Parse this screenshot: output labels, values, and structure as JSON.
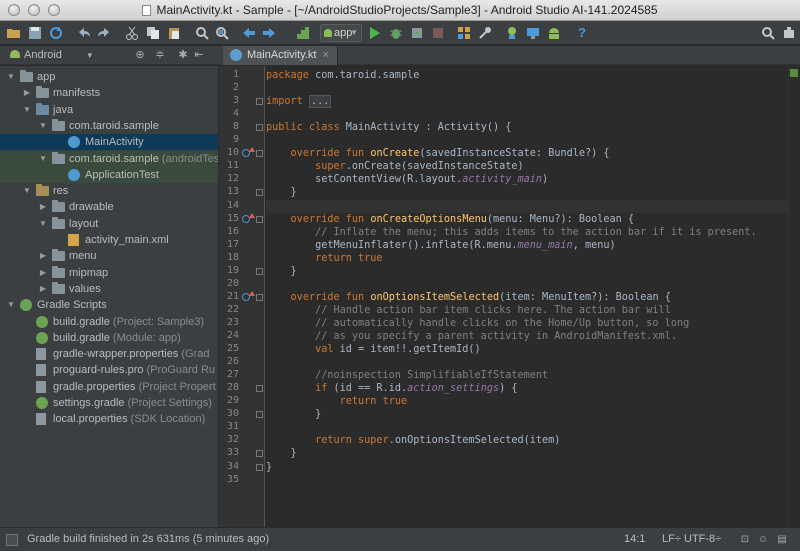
{
  "window": {
    "title": "MainActivity.kt - Sample - [~/AndroidStudioProjects/Sample3] - Android Studio AI-141.2024585"
  },
  "toolbar": {
    "run_config": "app",
    "icons": [
      "open-folder-icon",
      "save-icon",
      "sync-icon",
      "undo-icon",
      "redo-icon",
      "cut-icon",
      "copy-icon",
      "paste-icon",
      "find-icon",
      "replace-icon",
      "back-icon",
      "forward-icon",
      "build-icon",
      "run-icon",
      "debug-icon",
      "attach-icon",
      "stop-icon",
      "avd-manager-icon",
      "sdk-manager-icon",
      "gradle-sync-icon",
      "monitor-icon",
      "android-icon",
      "help-icon",
      "search-everywhere-icon",
      "settings-icon"
    ]
  },
  "project": {
    "view": "Android",
    "tree": [
      {
        "label": "app",
        "hint": "",
        "kind": "module",
        "depth": 0,
        "expanded": true
      },
      {
        "label": "manifests",
        "hint": "",
        "kind": "folder",
        "depth": 1,
        "expanded": false
      },
      {
        "label": "java",
        "hint": "",
        "kind": "src",
        "depth": 1,
        "expanded": true
      },
      {
        "label": "com.taroid.sample",
        "hint": "",
        "kind": "package",
        "depth": 2,
        "expanded": true
      },
      {
        "label": "MainActivity",
        "hint": "",
        "kind": "class",
        "depth": 3,
        "selected": true
      },
      {
        "label": "com.taroid.sample",
        "hint": "(androidTest)",
        "kind": "package",
        "depth": 2,
        "expanded": true,
        "test": true
      },
      {
        "label": "ApplicationTest",
        "hint": "",
        "kind": "class",
        "depth": 3,
        "test": true
      },
      {
        "label": "res",
        "hint": "",
        "kind": "res",
        "depth": 1,
        "expanded": true
      },
      {
        "label": "drawable",
        "hint": "",
        "kind": "folder",
        "depth": 2,
        "expanded": false
      },
      {
        "label": "layout",
        "hint": "",
        "kind": "folder",
        "depth": 2,
        "expanded": true
      },
      {
        "label": "activity_main.xml",
        "hint": "",
        "kind": "xml",
        "depth": 3
      },
      {
        "label": "menu",
        "hint": "",
        "kind": "folder",
        "depth": 2,
        "expanded": false
      },
      {
        "label": "mipmap",
        "hint": "",
        "kind": "folder",
        "depth": 2,
        "expanded": false
      },
      {
        "label": "values",
        "hint": "",
        "kind": "folder",
        "depth": 2,
        "expanded": false
      },
      {
        "label": "Gradle Scripts",
        "hint": "",
        "kind": "gradle-root",
        "depth": 0,
        "expanded": true
      },
      {
        "label": "build.gradle",
        "hint": "(Project: Sample3)",
        "kind": "gradle",
        "depth": 1
      },
      {
        "label": "build.gradle",
        "hint": "(Module: app)",
        "kind": "gradle",
        "depth": 1
      },
      {
        "label": "gradle-wrapper.properties",
        "hint": "(Grad",
        "kind": "file",
        "depth": 1
      },
      {
        "label": "proguard-rules.pro",
        "hint": "(ProGuard Ru",
        "kind": "file",
        "depth": 1
      },
      {
        "label": "gradle.properties",
        "hint": "(Project Propert",
        "kind": "file",
        "depth": 1
      },
      {
        "label": "settings.gradle",
        "hint": "(Project Settings)",
        "kind": "gradle",
        "depth": 1
      },
      {
        "label": "local.properties",
        "hint": "(SDK Location)",
        "kind": "file",
        "depth": 1
      }
    ]
  },
  "editor": {
    "tab": "MainActivity.kt",
    "cursor_line": 14,
    "lines": [
      "1|package com.taroid.sample",
      "2|",
      "3|import ...",
      "4|",
      "8|public class MainActivity : Activity() {",
      "9|",
      "10|    override fun onCreate(savedInstanceState: Bundle?) {",
      "11|        super.onCreate(savedInstanceState)",
      "12|        setContentView(R.layout.activity_main)",
      "13|    }",
      "14|",
      "15|    override fun onCreateOptionsMenu(menu: Menu?): Boolean {",
      "16|        // Inflate the menu; this adds items to the action bar if it is present.",
      "17|        getMenuInflater().inflate(R.menu.menu_main, menu)",
      "18|        return true",
      "19|    }",
      "20|",
      "21|    override fun onOptionsItemSelected(item: MenuItem?): Boolean {",
      "22|        // Handle action bar item clicks here. The action bar will",
      "23|        // automatically handle clicks on the Home/Up button, so long",
      "24|        // as you specify a parent activity in AndroidManifest.xml.",
      "25|        val id = item!!.getItemId()",
      "26|",
      "27|        //noinspection SimplifiableIfStatement",
      "28|        if (id == R.id.action_settings) {",
      "29|            return true",
      "30|        }",
      "31|",
      "32|        return super.onOptionsItemSelected(item)",
      "33|    }",
      "34|}",
      "35|"
    ]
  },
  "status": {
    "message": "Gradle build finished in 2s 631ms (5 minutes ago)",
    "position": "14:1",
    "line_separator": "LF÷",
    "encoding": "UTF-8÷"
  }
}
